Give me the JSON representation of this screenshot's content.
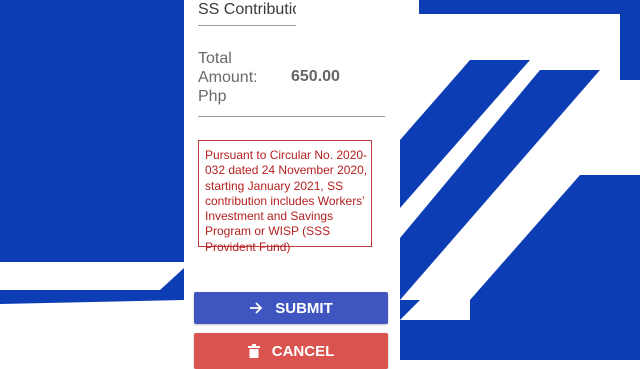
{
  "form": {
    "field_value": "SS Contribution",
    "total_label": "Total Amount: Php",
    "total_value": "650.00",
    "notice": "Pursuant to Circular No. 2020-032 dated 24 November 2020, starting January 2021, SS contribution includes Workers’ Investment and Savings Program or WISP (SSS Provident Fund)"
  },
  "buttons": {
    "submit_label": "SUBMIT",
    "submit_icon": "arrow-right-icon",
    "cancel_label": "CANCEL",
    "cancel_icon": "trash-icon"
  },
  "colors": {
    "brand_blue": "#0c3db4",
    "submit": "#3f56c0",
    "cancel": "#d9534f",
    "notice_red": "#b52020"
  }
}
